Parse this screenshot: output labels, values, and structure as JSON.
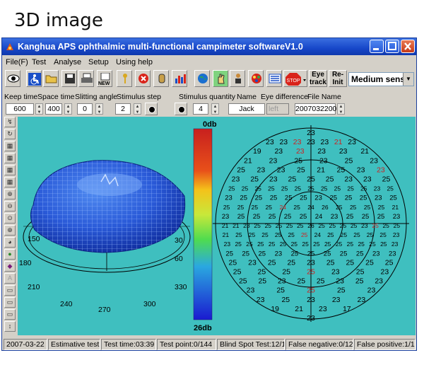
{
  "caption": "3D image",
  "window": {
    "title": "Kanghua APS ophthalmic multi-functional campimeter softwareV1.0"
  },
  "menu": [
    "File(F)",
    "Test",
    "Analyse",
    "Setup",
    "Using help"
  ],
  "toolbar": {
    "new_label": "NEW",
    "stop_label": "STOP",
    "eye_track": "Eye track",
    "reinit": "Re- Init",
    "speed_value": "Medium sens"
  },
  "params": {
    "labels": {
      "keep_time": "Keep time",
      "space_time": "Space time",
      "slitting_angle": "Slitting angle",
      "stimulus_step": "Stimulus step",
      "stimulus_quantity": "Stimulus quantity",
      "name": "Name",
      "eye_difference": "Eye difference",
      "file_name": "File Name"
    },
    "values": {
      "keep_time": "600",
      "space_time": "400",
      "slitting_angle": "0",
      "stimulus_step": "2",
      "stimulus_quantity": "4",
      "name": "Jack",
      "eye_difference": "left",
      "file_name": "2007032200"
    }
  },
  "scale_bar": {
    "top_label": "0db",
    "bottom_label": "26db"
  },
  "plot3d": {
    "angle_labels": [
      "150",
      "30",
      "180",
      "60",
      "210",
      "330",
      "240",
      "270",
      "300"
    ]
  },
  "field_map": {
    "colors": {
      "normal": "#000000",
      "defect": "#cc2222"
    },
    "rows": [
      [
        "23"
      ],
      [
        "23",
        "23",
        "23",
        "23",
        "23",
        "21",
        "23"
      ],
      [
        "19",
        "23",
        "23",
        "23",
        "23",
        "21"
      ],
      [
        "21",
        "23",
        "25",
        "23",
        "25",
        "23"
      ],
      [
        "25",
        "23",
        "23",
        "25",
        "21",
        "25",
        "23",
        "23"
      ],
      [
        "23",
        "25",
        "23",
        "25",
        "25",
        "25",
        "23",
        "23",
        "25"
      ],
      [
        "25",
        "25",
        "25",
        "25",
        "25",
        "25",
        "25",
        "25",
        "25",
        "25",
        "25",
        "23",
        "25"
      ],
      [
        "23",
        "25",
        "25",
        "25",
        "25",
        "25",
        "23",
        "25",
        "25",
        "25",
        "23",
        "25"
      ],
      [
        "25",
        "25",
        "25",
        "25",
        "24",
        "25",
        "24",
        "26",
        "25",
        "25",
        "25",
        "25",
        "21"
      ],
      [
        "23",
        "25",
        "25",
        "25",
        "25",
        "25",
        "24",
        "23",
        "25",
        "25",
        "25",
        "23"
      ],
      [
        "21",
        "21",
        "23",
        "25",
        "25",
        "25",
        "25",
        "25",
        "26",
        "25",
        "25",
        "25",
        "25",
        "23",
        "25",
        "25",
        "25"
      ],
      [
        "21",
        "25",
        "25",
        "25",
        "25",
        "25",
        "25",
        "24",
        "25",
        "25",
        "25",
        "25",
        "25",
        "23"
      ],
      [
        "23",
        "25",
        "25",
        "25",
        "25",
        "25",
        "25",
        "25",
        "25",
        "25",
        "25",
        "25",
        "25",
        "25",
        "25",
        "23"
      ],
      [
        "25",
        "25",
        "25",
        "23",
        "25",
        "25",
        "25",
        "25",
        "25",
        "23",
        "23"
      ],
      [
        "25",
        "23",
        "25",
        "25",
        "23",
        "25",
        "25",
        "25",
        "25"
      ],
      [
        "25",
        "25",
        "25",
        "25",
        "23",
        "25",
        "23"
      ],
      [
        "25",
        "25",
        "23",
        "25",
        "25",
        "23",
        "25",
        "23"
      ],
      [
        "23",
        "25",
        "25",
        "25",
        "23"
      ],
      [
        "23",
        "25",
        "23",
        "23",
        "23"
      ],
      [
        "19",
        "21",
        "23",
        "17"
      ],
      [
        "23"
      ]
    ]
  },
  "status": {
    "date": "2007-03-22",
    "mode": "Estimative test",
    "test_time": "Test time:03:39",
    "test_point": "Test point:0/144",
    "blind_spot": "Blind Spot Test:12/12",
    "false_negative": "False negative:0/12",
    "false_positive": "False positive:1/12"
  }
}
